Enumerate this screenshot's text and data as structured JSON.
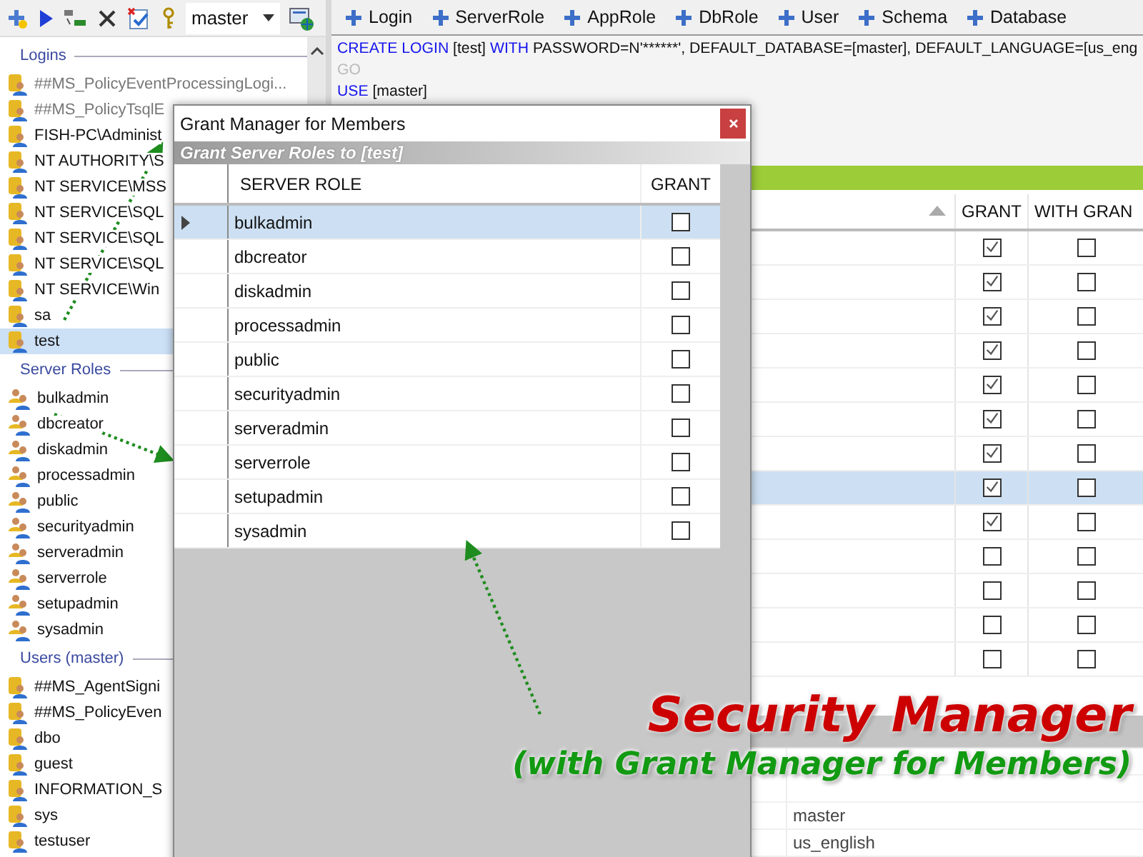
{
  "toolbar": {
    "database": "master"
  },
  "object_toolbar": [
    {
      "label": "Login"
    },
    {
      "label": "ServerRole"
    },
    {
      "label": "AppRole"
    },
    {
      "label": "DbRole"
    },
    {
      "label": "User"
    },
    {
      "label": "Schema"
    },
    {
      "label": "Database"
    }
  ],
  "tree": {
    "sections": [
      {
        "title": "Logins",
        "items": [
          {
            "label": "##MS_PolicyEventProcessingLogi...",
            "kind": "login",
            "disabled": true,
            "selected": false
          },
          {
            "label": "##MS_PolicyTsqlE",
            "kind": "login",
            "disabled": true,
            "selected": false
          },
          {
            "label": "FISH-PC\\Administ",
            "kind": "login",
            "disabled": false,
            "selected": false
          },
          {
            "label": "NT AUTHORITY\\S",
            "kind": "login",
            "disabled": false,
            "selected": false
          },
          {
            "label": "NT SERVICE\\MSS",
            "kind": "login",
            "disabled": false,
            "selected": false
          },
          {
            "label": "NT SERVICE\\SQL",
            "kind": "login",
            "disabled": false,
            "selected": false
          },
          {
            "label": "NT SERVICE\\SQL",
            "kind": "login",
            "disabled": false,
            "selected": false
          },
          {
            "label": "NT SERVICE\\SQL",
            "kind": "login",
            "disabled": false,
            "selected": false
          },
          {
            "label": "NT SERVICE\\Win",
            "kind": "login",
            "disabled": false,
            "selected": false
          },
          {
            "label": "sa",
            "kind": "login",
            "disabled": false,
            "selected": false
          },
          {
            "label": "test",
            "kind": "login",
            "disabled": false,
            "selected": true
          }
        ]
      },
      {
        "title": "Server Roles",
        "items": [
          {
            "label": "bulkadmin",
            "kind": "role",
            "disabled": false,
            "selected": false
          },
          {
            "label": "dbcreator",
            "kind": "role",
            "disabled": false,
            "selected": false
          },
          {
            "label": "diskadmin",
            "kind": "role",
            "disabled": false,
            "selected": false
          },
          {
            "label": "processadmin",
            "kind": "role",
            "disabled": false,
            "selected": false
          },
          {
            "label": "public",
            "kind": "role",
            "disabled": false,
            "selected": false
          },
          {
            "label": "securityadmin",
            "kind": "role",
            "disabled": false,
            "selected": false
          },
          {
            "label": "serveradmin",
            "kind": "role",
            "disabled": false,
            "selected": false
          },
          {
            "label": "serverrole",
            "kind": "role",
            "disabled": false,
            "selected": false
          },
          {
            "label": "setupadmin",
            "kind": "role",
            "disabled": false,
            "selected": false
          },
          {
            "label": "sysadmin",
            "kind": "role",
            "disabled": false,
            "selected": false
          }
        ]
      },
      {
        "title": "Users (master)",
        "items": [
          {
            "label": "##MS_AgentSigni",
            "kind": "login",
            "disabled": false,
            "selected": false
          },
          {
            "label": "##MS_PolicyEven",
            "kind": "login",
            "disabled": false,
            "selected": false
          },
          {
            "label": "dbo",
            "kind": "login",
            "disabled": false,
            "selected": false
          },
          {
            "label": "guest",
            "kind": "login",
            "disabled": false,
            "selected": false
          },
          {
            "label": "INFORMATION_S",
            "kind": "login",
            "disabled": false,
            "selected": false
          },
          {
            "label": "sys",
            "kind": "login",
            "disabled": false,
            "selected": false
          },
          {
            "label": "testuser",
            "kind": "login",
            "disabled": false,
            "selected": false
          }
        ]
      }
    ]
  },
  "editor": {
    "lines": [
      [
        {
          "text": "CREATE LOGIN",
          "kind": "keyword"
        },
        {
          "text": " [test] ",
          "kind": "plain"
        },
        {
          "text": "WITH",
          "kind": "keyword"
        },
        {
          "text": " PASSWORD=N'******', DEFAULT_DATABASE=[master], DEFAULT_LANGUAGE=[us_eng",
          "kind": "plain"
        }
      ],
      [
        {
          "text": "GO",
          "kind": "dim"
        }
      ],
      [
        {
          "text": "USE",
          "kind": "keyword"
        },
        {
          "text": " [master]",
          "kind": "plain"
        }
      ]
    ]
  },
  "permissions_grid": {
    "columns": [
      "GRANT",
      "WITH GRAN"
    ],
    "rows": [
      {
        "grant": true,
        "with_grant": false,
        "selected": false
      },
      {
        "grant": true,
        "with_grant": false,
        "selected": false
      },
      {
        "grant": true,
        "with_grant": false,
        "selected": false
      },
      {
        "grant": true,
        "with_grant": false,
        "selected": false
      },
      {
        "grant": true,
        "with_grant": false,
        "selected": false
      },
      {
        "grant": true,
        "with_grant": false,
        "selected": false
      },
      {
        "grant": true,
        "with_grant": false,
        "selected": false
      },
      {
        "grant": true,
        "with_grant": false,
        "selected": true
      },
      {
        "grant": true,
        "with_grant": false,
        "selected": false
      },
      {
        "grant": false,
        "with_grant": false,
        "selected": false
      },
      {
        "grant": false,
        "with_grant": false,
        "selected": false
      },
      {
        "grant": false,
        "with_grant": false,
        "selected": false
      },
      {
        "grant": false,
        "with_grant": false,
        "selected": false
      }
    ]
  },
  "properties": {
    "rows": [
      {
        "value": "master"
      },
      {
        "value": "us_english"
      }
    ]
  },
  "dialog": {
    "title": "Grant Manager for Members",
    "subtitle": "Grant Server Roles to [test]",
    "columns": [
      "SERVER ROLE",
      "GRANT"
    ],
    "rows": [
      {
        "role": "bulkadmin",
        "grant": false,
        "selected": true
      },
      {
        "role": "dbcreator",
        "grant": false,
        "selected": false
      },
      {
        "role": "diskadmin",
        "grant": false,
        "selected": false
      },
      {
        "role": "processadmin",
        "grant": false,
        "selected": false
      },
      {
        "role": "public",
        "grant": false,
        "selected": false
      },
      {
        "role": "securityadmin",
        "grant": false,
        "selected": false
      },
      {
        "role": "serveradmin",
        "grant": false,
        "selected": false
      },
      {
        "role": "serverrole",
        "grant": false,
        "selected": false
      },
      {
        "role": "setupadmin",
        "grant": false,
        "selected": false
      },
      {
        "role": "sysadmin",
        "grant": false,
        "selected": false
      }
    ]
  },
  "caption": {
    "title": "Security Manager",
    "subtitle": "(with Grant Manager for Members)"
  }
}
